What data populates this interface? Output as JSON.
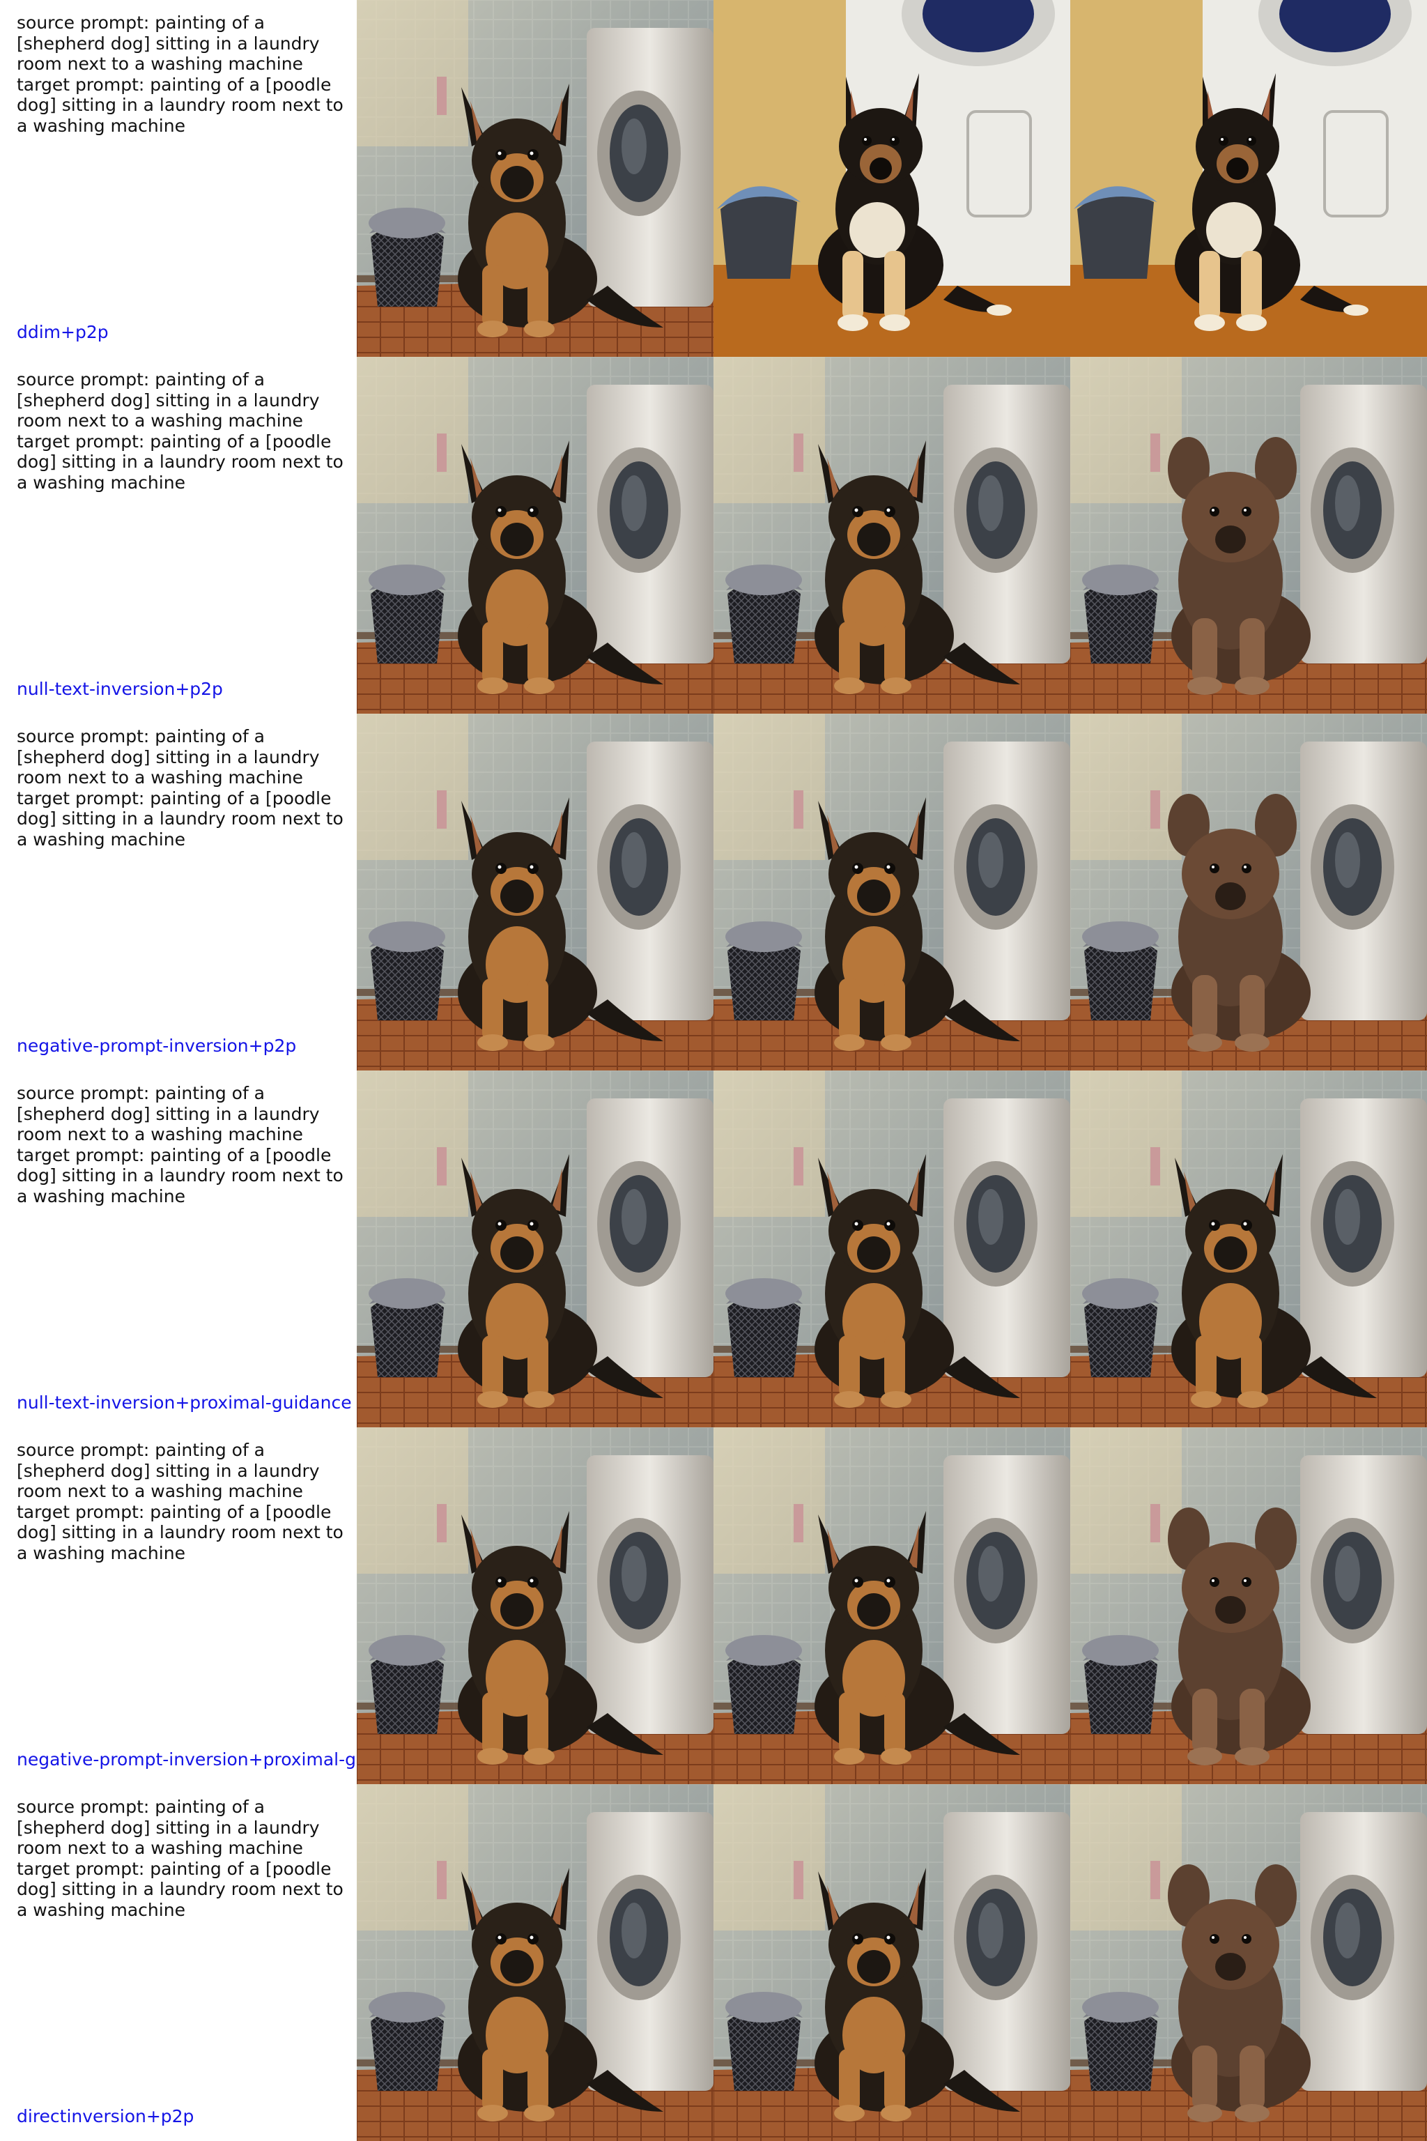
{
  "rows": [
    {
      "prompt_lines": [
        "source prompt: painting of a",
        "[shepherd dog] sitting in a laundry",
        "room next to a washing machine",
        "target prompt: painting of a [poodle",
        "dog] sitting in a laundry room next to",
        "a washing machine"
      ],
      "method": "ddim+p2p",
      "images": [
        "source-image",
        "reconstruction-image",
        "edited-image"
      ]
    },
    {
      "prompt_lines": [
        "source prompt: painting of a",
        "[shepherd dog] sitting in a laundry",
        "room next to a washing machine",
        "target prompt: painting of a [poodle",
        "dog] sitting in a laundry room next to",
        "a washing machine"
      ],
      "method": "null-text-inversion+p2p",
      "images": [
        "source-image",
        "reconstruction-image",
        "edited-image"
      ]
    },
    {
      "prompt_lines": [
        "source prompt: painting of a",
        "[shepherd dog] sitting in a laundry",
        "room next to a washing machine",
        "target prompt: painting of a [poodle",
        "dog] sitting in a laundry room next to",
        "a washing machine"
      ],
      "method": "negative-prompt-inversion+p2p",
      "images": [
        "source-image",
        "reconstruction-image",
        "edited-image"
      ]
    },
    {
      "prompt_lines": [
        "source prompt: painting of a",
        "[shepherd dog] sitting in a laundry",
        "room next to a washing machine",
        "target prompt: painting of a [poodle",
        "dog] sitting in a laundry room next to",
        "a washing machine"
      ],
      "method": "null-text-inversion+proximal-guidance",
      "images": [
        "source-image",
        "reconstruction-image",
        "edited-image"
      ]
    },
    {
      "prompt_lines": [
        "source prompt: painting of a",
        "[shepherd dog] sitting in a laundry",
        "room next to a washing machine",
        "target prompt: painting of a [poodle",
        "dog] sitting in a laundry room next to",
        "a washing machine"
      ],
      "method": "negative-prompt-inversion+proximal-g",
      "images": [
        "source-image",
        "reconstruction-image",
        "edited-image"
      ]
    },
    {
      "prompt_lines": [
        "source prompt: painting of a",
        "[shepherd dog] sitting in a laundry",
        "room next to a washing machine",
        "target prompt: painting of a [poodle",
        "dog] sitting in a laundry room next to",
        "a washing machine"
      ],
      "method": "directinversion+p2p",
      "images": [
        "source-image",
        "reconstruction-image",
        "edited-image"
      ]
    }
  ],
  "colors": {
    "prompt_text": "#111111",
    "method_text": "#1414e6",
    "wall_tile": "#7d8a92",
    "floor_tile": "#a0552b",
    "washer": "#d9d6d0",
    "shepherd_black": "#1c1712",
    "shepherd_tan": "#b7773a",
    "poodle_brown": "#6b4a35"
  }
}
